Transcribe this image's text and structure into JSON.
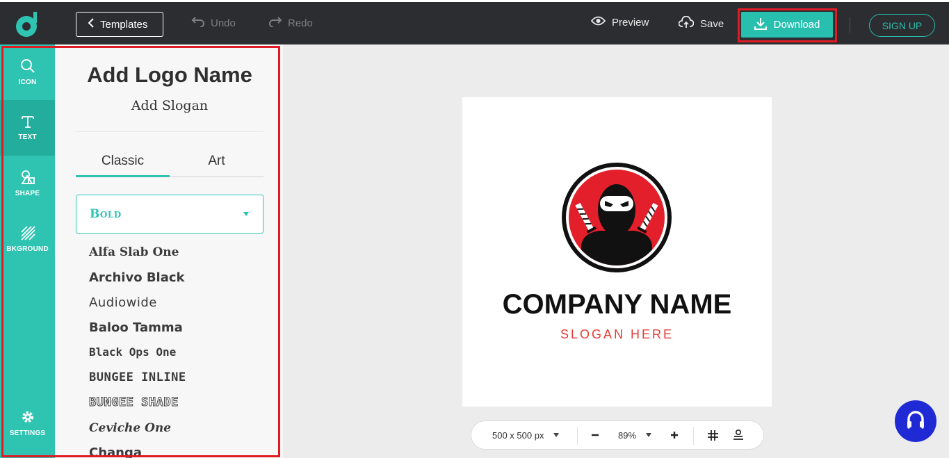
{
  "toolbar": {
    "templates_label": "Templates",
    "undo_label": "Undo",
    "redo_label": "Redo",
    "preview_label": "Preview",
    "save_label": "Save",
    "download_label": "Download",
    "signup_label": "SIGN UP"
  },
  "sidebar": {
    "items": [
      {
        "label": "ICON",
        "icon": "search-icon"
      },
      {
        "label": "TEXT",
        "icon": "text-icon"
      },
      {
        "label": "SHAPE",
        "icon": "shape-icon"
      },
      {
        "label": "BKGROUND",
        "icon": "background-icon"
      },
      {
        "label": "SETTINGS",
        "icon": "gear-icon"
      }
    ]
  },
  "panel": {
    "add_logo_name": "Add Logo Name",
    "add_slogan": "Add Slogan",
    "tabs": [
      {
        "label": "Classic"
      },
      {
        "label": "Art"
      }
    ],
    "font_category": "Bold",
    "fonts": [
      "Alfa Slab One",
      "Archivo Black",
      "Audiowide",
      "Baloo Tamma",
      "Black Ops One",
      "BUNGEE INLINE",
      "BUNGEE SHADE",
      "Ceviche One",
      "Changa"
    ]
  },
  "canvas": {
    "company_name": "COMPANY NAME",
    "slogan": "SLOGAN HERE"
  },
  "zoom_bar": {
    "size": "500 x 500 px",
    "zoom": "89%"
  },
  "colors": {
    "accent": "#2fc4b1",
    "highlight": "#e01b24",
    "topbar": "#2b2d31",
    "chat": "#1f2ad4"
  }
}
